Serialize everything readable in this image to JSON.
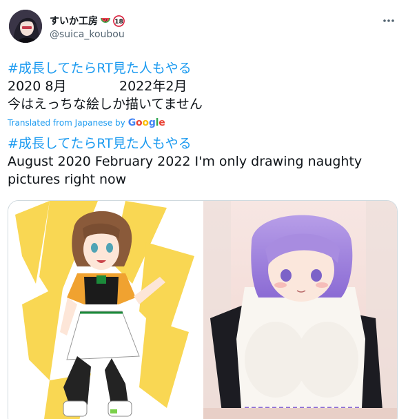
{
  "author": {
    "display_name": "すいか工房",
    "handle": "@suica_koubou",
    "badge_emoji": "watermelon-icon",
    "age_badge": "18"
  },
  "tweet": {
    "original_hashtag": "#成長してたらRT見た人もやる",
    "original_date_from": "2020 8月",
    "original_date_to": "2022年2月",
    "original_line3": "今はえっちな絵しか描いてません",
    "translated_label": "Translated from Japanese by",
    "translator_brand": "Google",
    "translated_hashtag": "#成長してたらRT見た人もやる",
    "translated_text": " August 2020 February 2022 I'm only drawing naughty pictures right now"
  },
  "media": {
    "count": 2,
    "items": [
      {
        "name": "drawing-2020",
        "alt_subject": "brown-haired girl in orange top jumping on yellow background"
      },
      {
        "name": "drawing-2022",
        "alt_subject": "purple-haired girl in white shirt leaning forward"
      }
    ]
  },
  "colors": {
    "accent": "#1d9bf0",
    "text": "#0f1419",
    "secondary": "#536471",
    "border": "#cfd9de"
  },
  "icons": {
    "more": "more-horizontal-icon",
    "age": "age-18-icon"
  }
}
